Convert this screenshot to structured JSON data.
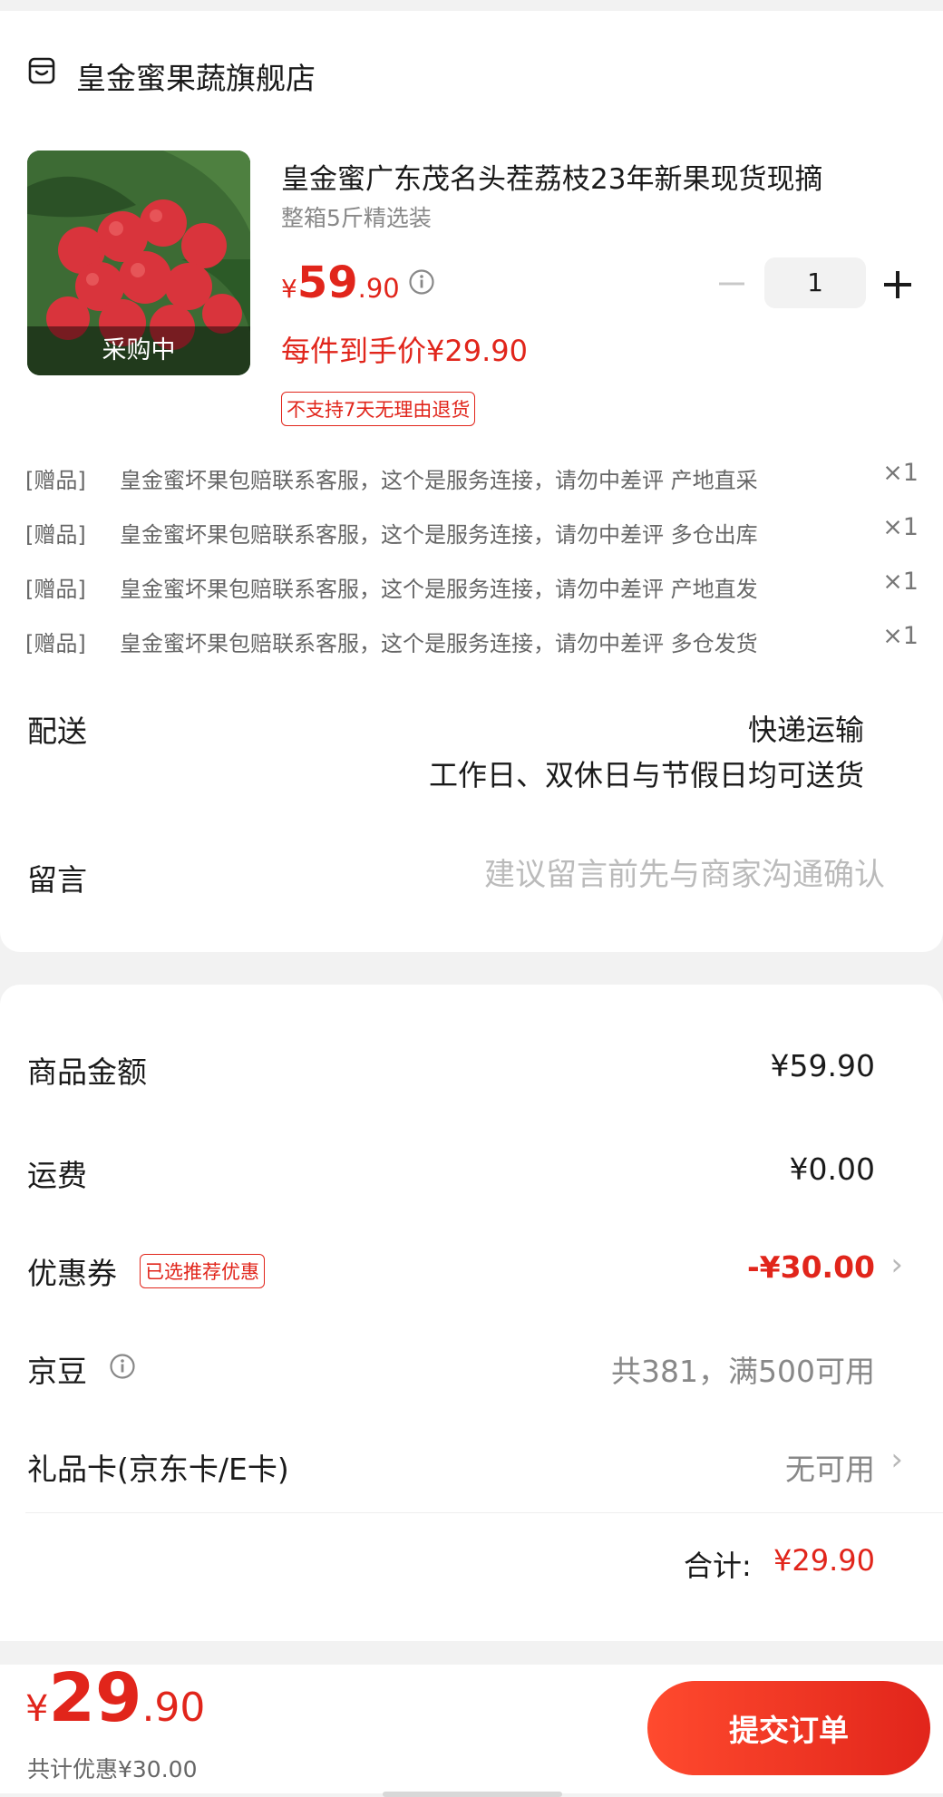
{
  "shop": {
    "name": "皇金蜜果蔬旗舰店",
    "icon": "store-icon"
  },
  "product": {
    "title": "皇金蜜广东茂名头茬荔枝23年新果现货现摘",
    "spec": "整箱5斤精选装",
    "image_badge": "采购中",
    "price_currency": "¥",
    "price_integer": "59",
    "price_decimal": ".90",
    "unit_price": "每件到手价¥29.90",
    "return_policy": "不支持7天无理由退货",
    "quantity": "1"
  },
  "gifts": [
    {
      "tag": "[赠品]",
      "text": "皇金蜜坏果包赔联系客服，这个是服务连接，请勿中差评 产地直采",
      "qty": "×1"
    },
    {
      "tag": "[赠品]",
      "text": "皇金蜜坏果包赔联系客服，这个是服务连接，请勿中差评 多仓出库",
      "qty": "×1"
    },
    {
      "tag": "[赠品]",
      "text": "皇金蜜坏果包赔联系客服，这个是服务连接，请勿中差评 产地直发",
      "qty": "×1"
    },
    {
      "tag": "[赠品]",
      "text": "皇金蜜坏果包赔联系客服，这个是服务连接，请勿中差评 多仓发货",
      "qty": "×1"
    }
  ],
  "delivery": {
    "label": "配送",
    "value": "快递运输",
    "sub": "工作日、双休日与节假日均可送货"
  },
  "message": {
    "label": "留言",
    "placeholder": "建议留言前先与商家沟通确认"
  },
  "summary": {
    "goods_label": "商品金额",
    "goods_amount": "¥59.90",
    "shipping_label": "运费",
    "shipping_amount": "¥0.00",
    "coupon_label": "优惠券",
    "coupon_tag": "已选推荐优惠",
    "coupon_amount": "-¥30.00",
    "jingdou_label": "京豆",
    "jingdou_value": "共381，满500可用",
    "giftcard_label": "礼品卡(京东卡/E卡)",
    "giftcard_value": "无可用",
    "total_label": "合计:",
    "total_amount": "¥29.90"
  },
  "bottom": {
    "price_currency": "¥",
    "price_integer": "29",
    "price_decimal": ".90",
    "discount": "共计优惠¥30.00",
    "submit_label": "提交订单"
  },
  "colors": {
    "accent": "#e1251b",
    "muted": "#888888",
    "background": "#f2f2f2"
  }
}
